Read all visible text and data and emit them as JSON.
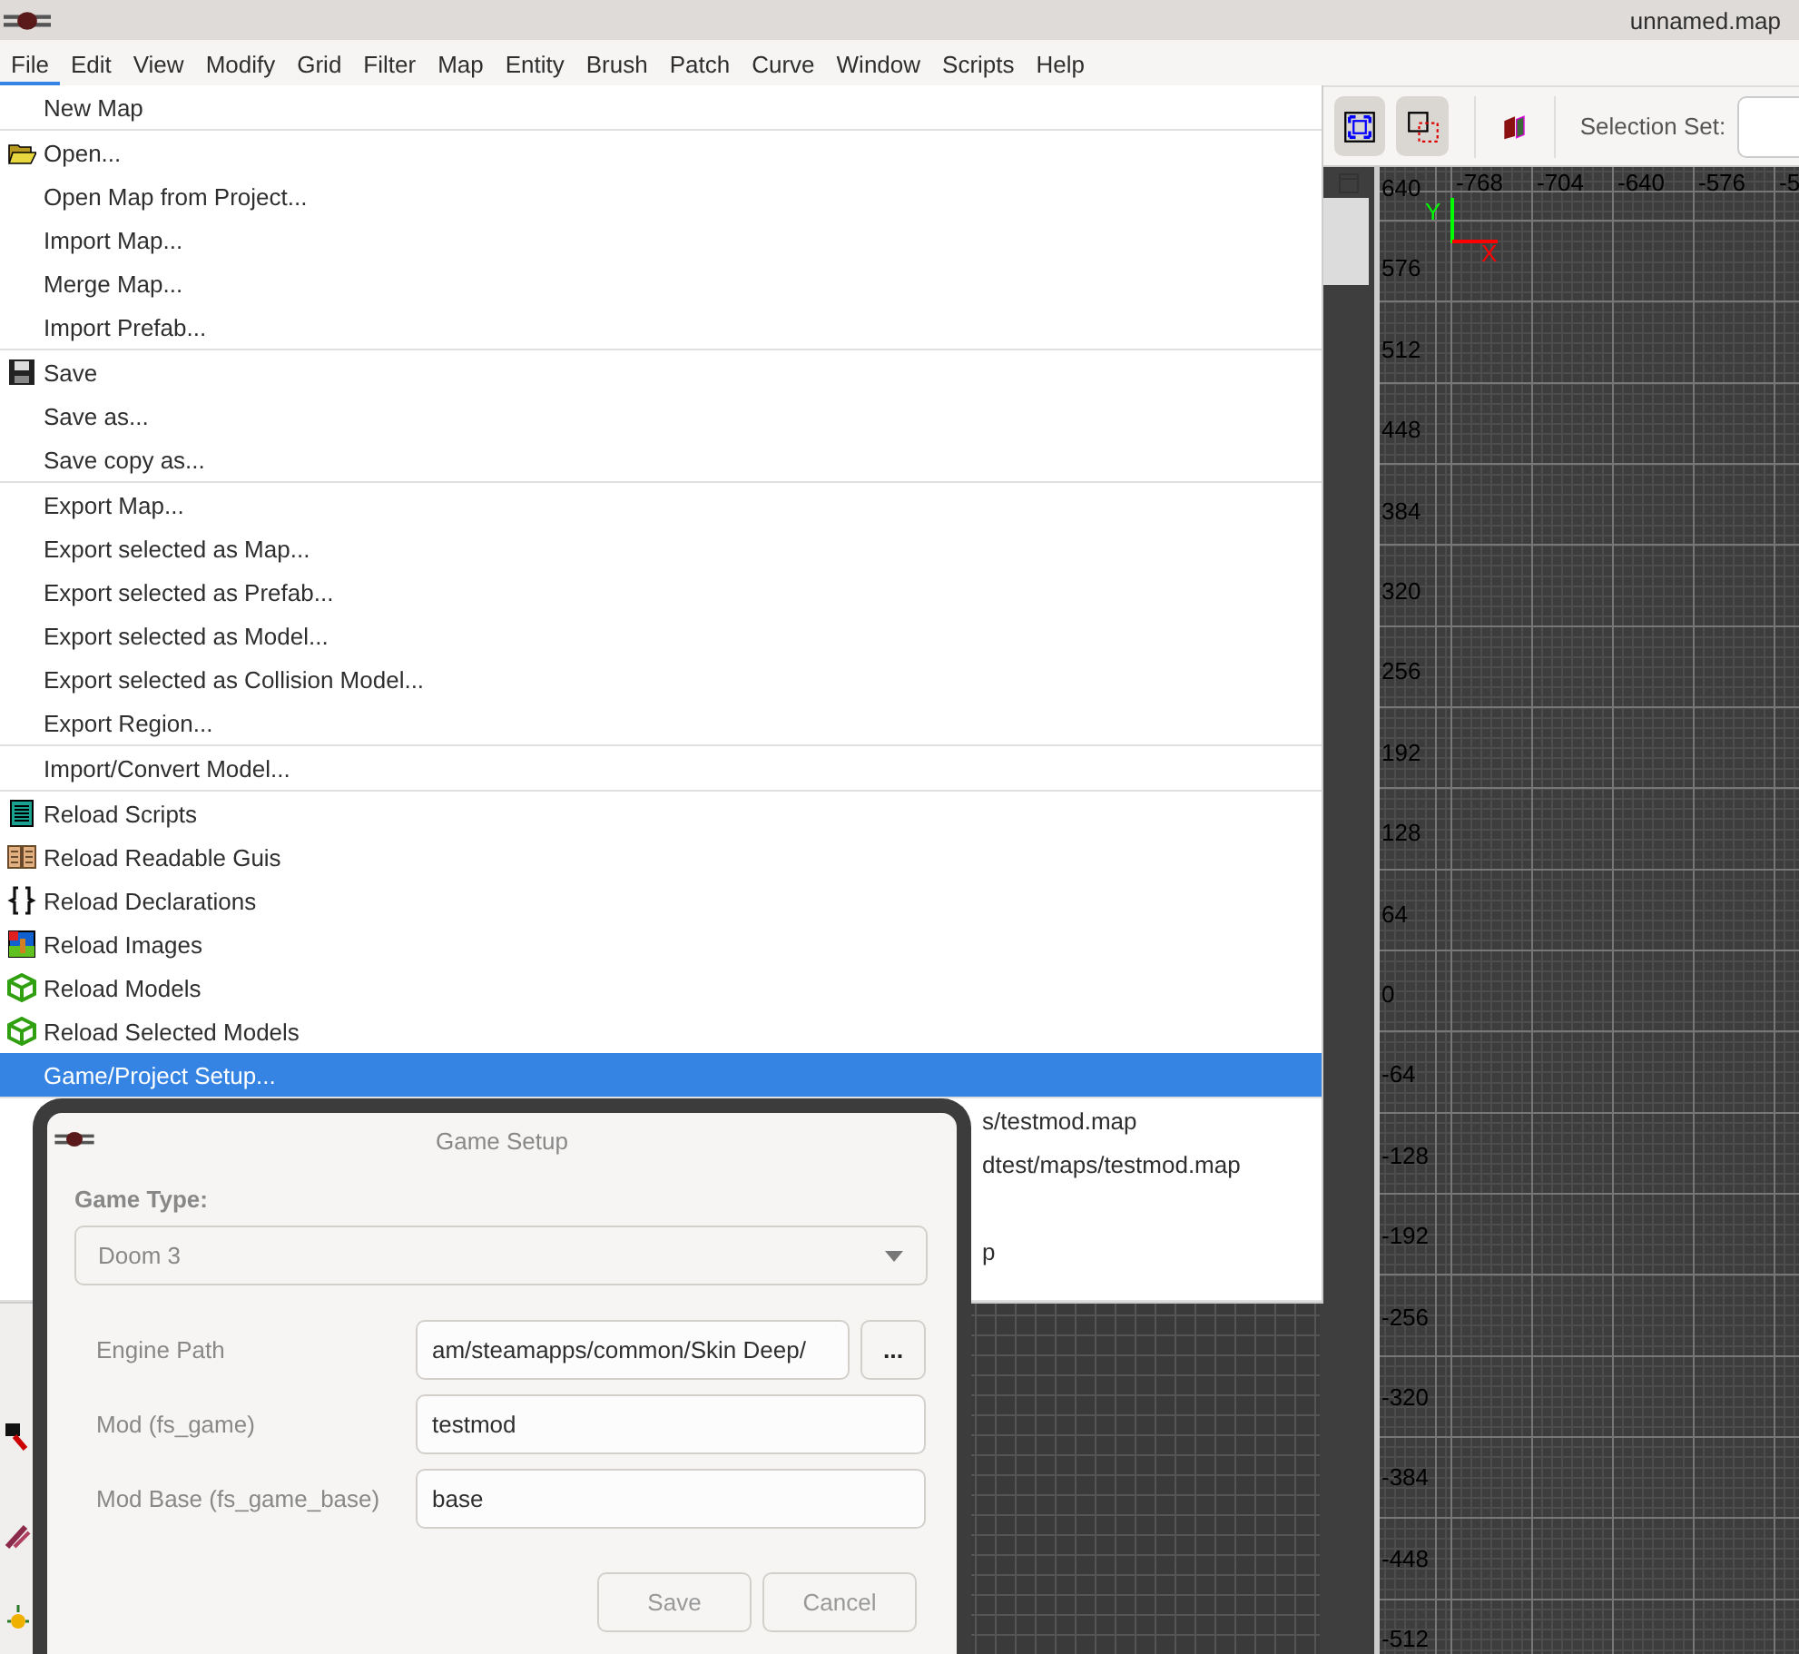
{
  "window": {
    "title": "unnamed.map"
  },
  "menubar": [
    {
      "label": "File",
      "selected": true
    },
    {
      "label": "Edit",
      "selected": false
    },
    {
      "label": "View",
      "selected": false
    },
    {
      "label": "Modify",
      "selected": false
    },
    {
      "label": "Grid",
      "selected": false
    },
    {
      "label": "Filter",
      "selected": false
    },
    {
      "label": "Map",
      "selected": false
    },
    {
      "label": "Entity",
      "selected": false
    },
    {
      "label": "Brush",
      "selected": false
    },
    {
      "label": "Patch",
      "selected": false
    },
    {
      "label": "Curve",
      "selected": false
    },
    {
      "label": "Window",
      "selected": false
    },
    {
      "label": "Scripts",
      "selected": false
    },
    {
      "label": "Help",
      "selected": false
    }
  ],
  "file_menu": {
    "groups": [
      [
        {
          "label": "New Map",
          "selected": false
        }
      ],
      [
        {
          "label": "Open...",
          "selected": false
        },
        {
          "label": "Open Map from Project...",
          "selected": false
        },
        {
          "label": "Import Map...",
          "selected": false
        },
        {
          "label": "Merge Map...",
          "selected": false
        },
        {
          "label": "Import Prefab...",
          "selected": false
        }
      ],
      [
        {
          "label": "Save",
          "selected": false
        },
        {
          "label": "Save as...",
          "selected": false
        },
        {
          "label": "Save copy as...",
          "selected": false
        }
      ],
      [
        {
          "label": "Export Map...",
          "selected": false
        },
        {
          "label": "Export selected as Map...",
          "selected": false
        },
        {
          "label": "Export selected as Prefab...",
          "selected": false
        },
        {
          "label": "Export selected as Model...",
          "selected": false
        },
        {
          "label": "Export selected as Collision Model...",
          "selected": false
        },
        {
          "label": "Export Region...",
          "selected": false
        }
      ],
      [
        {
          "label": "Import/Convert Model...",
          "selected": false
        }
      ],
      [
        {
          "label": "Reload Scripts",
          "selected": false
        },
        {
          "label": "Reload Readable Guis",
          "selected": false
        },
        {
          "label": "Reload Declarations",
          "selected": false
        },
        {
          "label": "Reload Images",
          "selected": false
        },
        {
          "label": "Reload Models",
          "selected": false
        },
        {
          "label": "Reload Selected Models",
          "selected": false
        },
        {
          "label": "Game/Project Setup...",
          "selected": true
        }
      ]
    ],
    "recent_files": [
      "s/testmod.map",
      "dtest/maps/testmod.map",
      "p"
    ]
  },
  "toolbar": {
    "selection_set_label": "Selection Set:"
  },
  "grid_view": {
    "axis_x": "X",
    "axis_y": "Y",
    "x_labels": [
      "-768",
      "-704",
      "-640",
      "-576",
      "-5"
    ],
    "y_labels": [
      "640",
      "576",
      "512",
      "448",
      "384",
      "320",
      "256",
      "192",
      "128",
      "64",
      "0",
      "-64",
      "-128",
      "-192",
      "-256",
      "-320",
      "-384",
      "-448",
      "-512"
    ]
  },
  "dialog": {
    "title": "Game Setup",
    "game_type_label": "Game Type:",
    "game_type": "Doom 3",
    "fields": [
      {
        "label": "Engine Path",
        "value": "am/steamapps/common/Skin Deep/",
        "browse": "..."
      },
      {
        "label": "Mod (fs_game)",
        "value": "testmod"
      },
      {
        "label": "Mod Base (fs_game_base)",
        "value": "base"
      }
    ],
    "buttons": [
      "Save",
      "Cancel"
    ]
  }
}
